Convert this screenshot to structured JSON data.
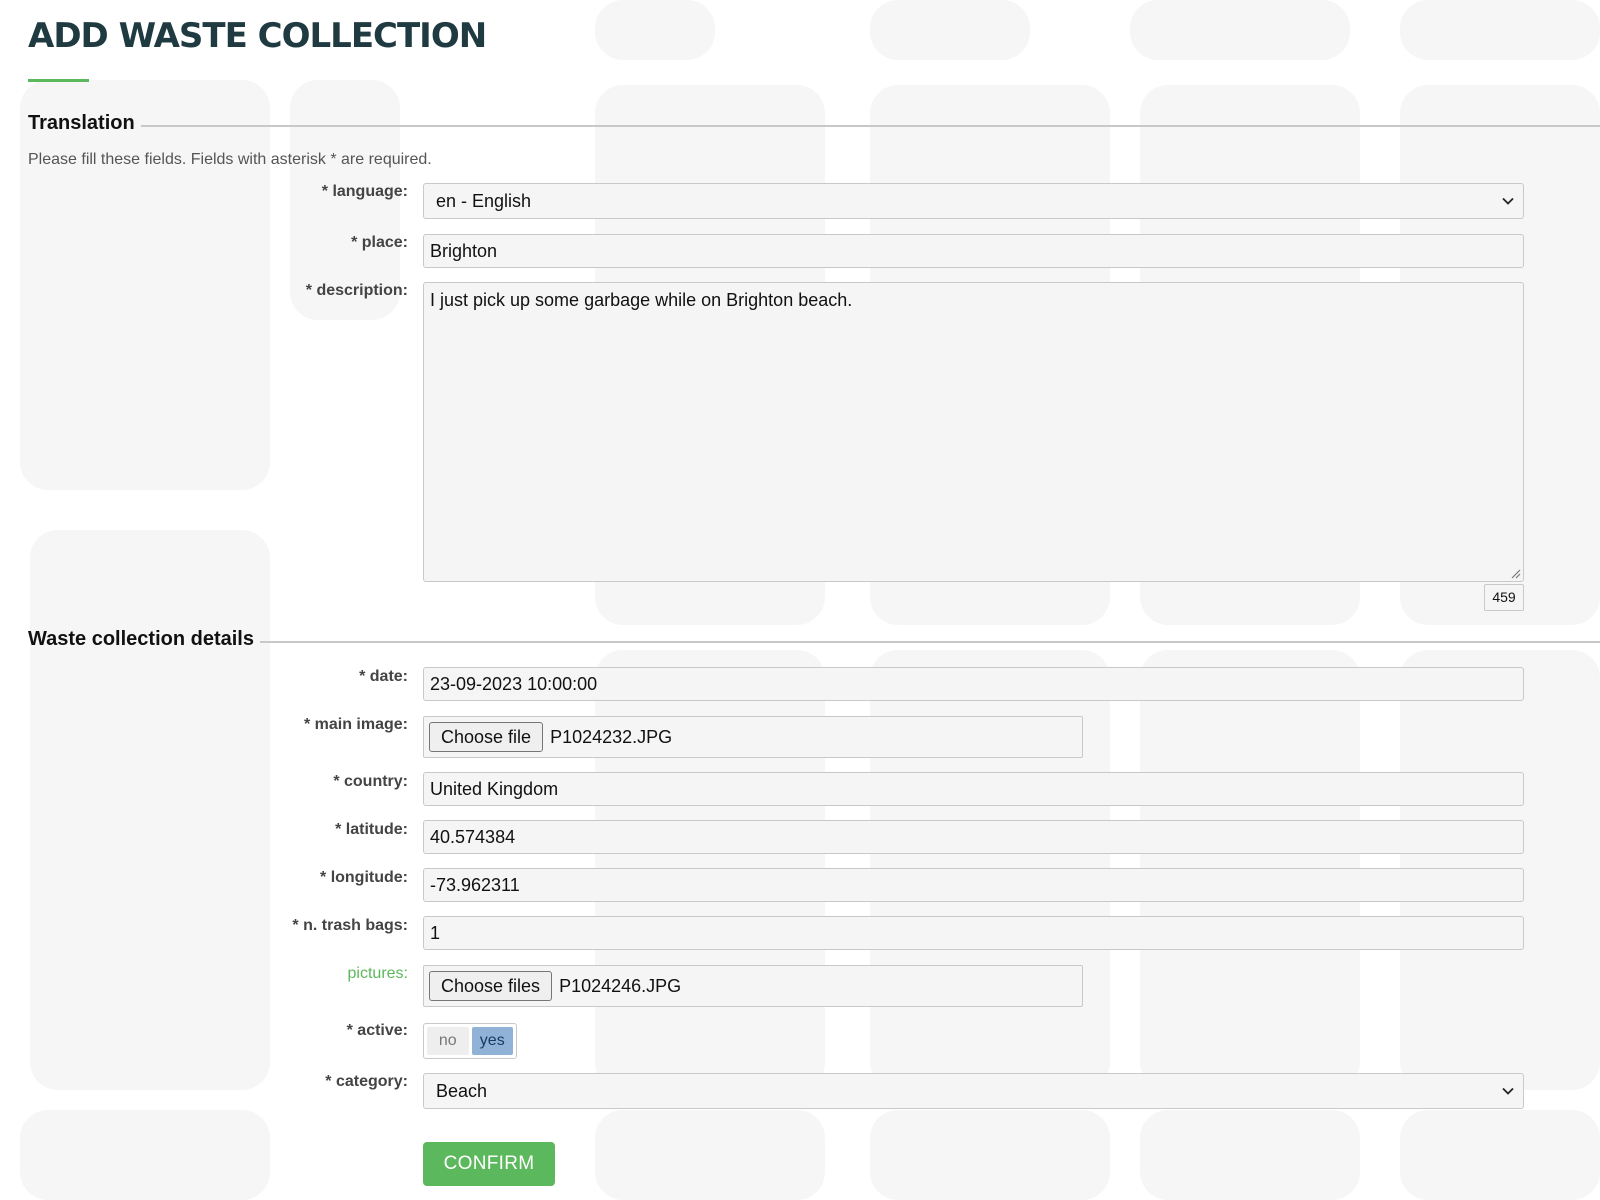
{
  "page": {
    "title": "ADD WASTE COLLECTION"
  },
  "translation": {
    "legend": "Translation",
    "hint": "Please fill these fields. Fields with asterisk * are required.",
    "language": {
      "label": "* language:",
      "value": "en - English"
    },
    "place": {
      "label": "* place:",
      "value": "Brighton"
    },
    "description": {
      "label": "* description:",
      "value": "I just pick up some garbage while on Brighton beach.",
      "remaining": "459"
    }
  },
  "details": {
    "legend": "Waste collection details",
    "date": {
      "label": "* date:",
      "value": "23-09-2023 10:00:00"
    },
    "main_image": {
      "label": "* main image:",
      "button": "Choose file",
      "file": "P1024232.JPG"
    },
    "country": {
      "label": "* country:",
      "value": "United Kingdom"
    },
    "latitude": {
      "label": "* latitude:",
      "value": "40.574384"
    },
    "longitude": {
      "label": "* longitude:",
      "value": "-73.962311"
    },
    "trash_bags": {
      "label": "* n. trash bags:",
      "value": "1"
    },
    "pictures": {
      "label": "pictures:",
      "button": "Choose files",
      "file": "P1024246.JPG"
    },
    "active": {
      "label": "* active:",
      "no": "no",
      "yes": "yes",
      "selected": "yes"
    },
    "category": {
      "label": "* category:",
      "value": "Beach"
    }
  },
  "confirm_label": "CONFIRM",
  "colors": {
    "accent": "#5cb85c",
    "title": "#1f3a40",
    "toggle_on": "#8fb2d6"
  },
  "icons": {
    "select_arrow": "chevron-down-icon",
    "textarea_grip": "resize-grip-icon"
  }
}
